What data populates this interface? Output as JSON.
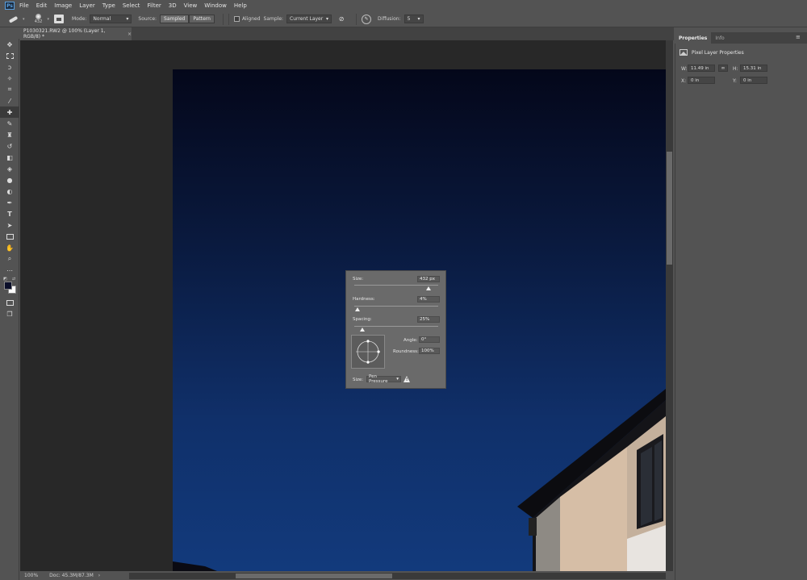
{
  "menu": {
    "logo": "Ps",
    "items": [
      "File",
      "Edit",
      "Image",
      "Layer",
      "Type",
      "Select",
      "Filter",
      "3D",
      "View",
      "Window",
      "Help"
    ]
  },
  "options": {
    "brush_size": "432",
    "mode_label": "Mode:",
    "mode_value": "Normal",
    "source_label": "Source:",
    "sampled_label": "Sampled",
    "pattern_label": "Pattern",
    "aligned_label": "Aligned",
    "sample_label": "Sample:",
    "sample_value": "Current Layer",
    "diffusion_label": "Diffusion:",
    "diffusion_value": "5"
  },
  "document": {
    "tab_title": "P1030321.RW2 @ 100% (Layer 1, RGB/8) *",
    "close": "×"
  },
  "status": {
    "zoom": "100%",
    "doc_info": "Doc: 45.3M/87.3M",
    "arrow": "›"
  },
  "panel": {
    "tabs": [
      "Properties",
      "Info"
    ],
    "section_title": "Pixel Layer Properties",
    "w_label": "W:",
    "w_value": "11.49 in",
    "h_label": "H:",
    "h_value": "15.31 in",
    "x_label": "X:",
    "x_value": "0 in",
    "y_label": "Y:",
    "y_value": "0 in"
  },
  "brush_popup": {
    "size_label": "Size:",
    "size_value": "432 px",
    "size_level": 0.88,
    "hardness_label": "Hardness:",
    "hardness_value": "4%",
    "hardness_level": 0.04,
    "spacing_label": "Spacing:",
    "spacing_value": "25%",
    "spacing_level": 0.1,
    "angle_label": "Angle:",
    "angle_value": "0°",
    "roundness_label": "Roundness:",
    "roundness_value": "100%",
    "dynamics_label": "Size:",
    "dynamics_value": "Pen Pressure"
  },
  "colors": {
    "foreground": "#0b0f2a",
    "background": "#ffffff"
  }
}
